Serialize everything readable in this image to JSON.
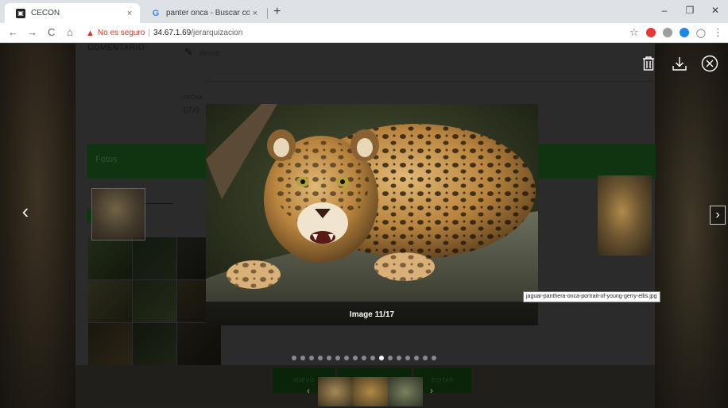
{
  "browser": {
    "tabs": [
      {
        "title": "CECON",
        "favicon": "cecon-favicon"
      },
      {
        "title": "panter onca - Buscar con Google",
        "favicon": "google-favicon"
      }
    ],
    "tab_close_glyph": "×",
    "new_tab_glyph": "+",
    "window_controls": {
      "minimize": "–",
      "maximize": "❐",
      "close": "✕"
    },
    "nav": {
      "back": "←",
      "forward": "→",
      "reload": "C",
      "home": "⌂"
    },
    "security_label": "No es seguro",
    "url_host": "34.67.1.69",
    "url_path": "/jerarquizacion",
    "star_glyph": "☆",
    "menu_glyph": "⋮",
    "extension_colors": [
      "#e53935",
      "#9e9e9e",
      "#1e88e5"
    ],
    "profile_glyph": "◯"
  },
  "page": {
    "comentario_label": "COMENTARIO:",
    "anote_placeholder": "Anote",
    "fecha_label": "FECHA",
    "fecha_value": "07/0",
    "fotos_label": "Fotos",
    "buttons": [
      "NUEVO",
      "",
      "EDITAR"
    ]
  },
  "lightbox": {
    "caption": "Image 11/17",
    "tooltip": "jaguar-panthera-onca-portrait-of-young-gerry-ellis.jpg",
    "total_images": 17,
    "current_index": 11,
    "toolbar": {
      "delete": "🗑",
      "download": "⤓",
      "close": "⊗"
    },
    "prev_glyph": "‹",
    "next_glyph": "›"
  },
  "colors": {
    "accent_green": "#1a5b1a",
    "overlay": "rgba(0,0,0,0.42)",
    "danger": "#d93025"
  }
}
